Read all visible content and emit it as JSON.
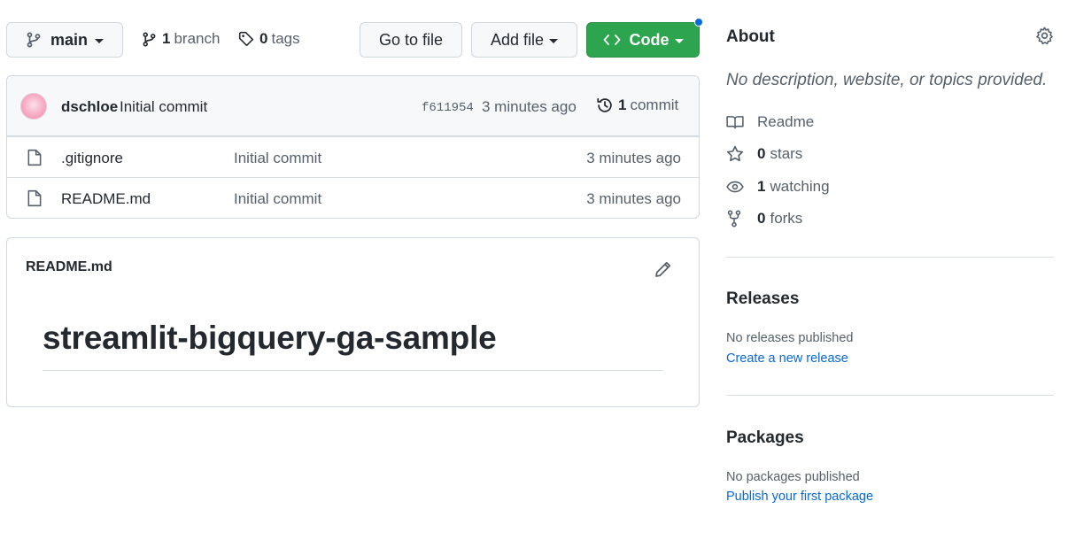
{
  "toolbar": {
    "branch_selector": "main",
    "branch_count": "1",
    "branch_label": "branch",
    "tag_count": "0",
    "tag_label": "tags",
    "go_to_file": "Go to file",
    "add_file": "Add file",
    "code": "Code"
  },
  "commit": {
    "author": "dschloe",
    "message": "Initial commit",
    "sha": "f611954",
    "time": "3 minutes ago",
    "commit_count": "1",
    "commit_label": "commit"
  },
  "files": [
    {
      "name": ".gitignore",
      "message": "Initial commit",
      "time": "3 minutes ago"
    },
    {
      "name": "README.md",
      "message": "Initial commit",
      "time": "3 minutes ago"
    }
  ],
  "readme": {
    "filename": "README.md",
    "heading": "streamlit-bigquery-ga-sample"
  },
  "about": {
    "title": "About",
    "description": "No description, website, or topics provided.",
    "readme_label": "Readme",
    "stars_count": "0",
    "stars_label": "stars",
    "watching_count": "1",
    "watching_label": "watching",
    "forks_count": "0",
    "forks_label": "forks"
  },
  "releases": {
    "title": "Releases",
    "empty": "No releases published",
    "link": "Create a new release"
  },
  "packages": {
    "title": "Packages",
    "empty": "No packages published",
    "link": "Publish your first package"
  },
  "colors": {
    "code_button": "#2da44e",
    "link": "#0969da",
    "notification_dot": "#0969da"
  }
}
